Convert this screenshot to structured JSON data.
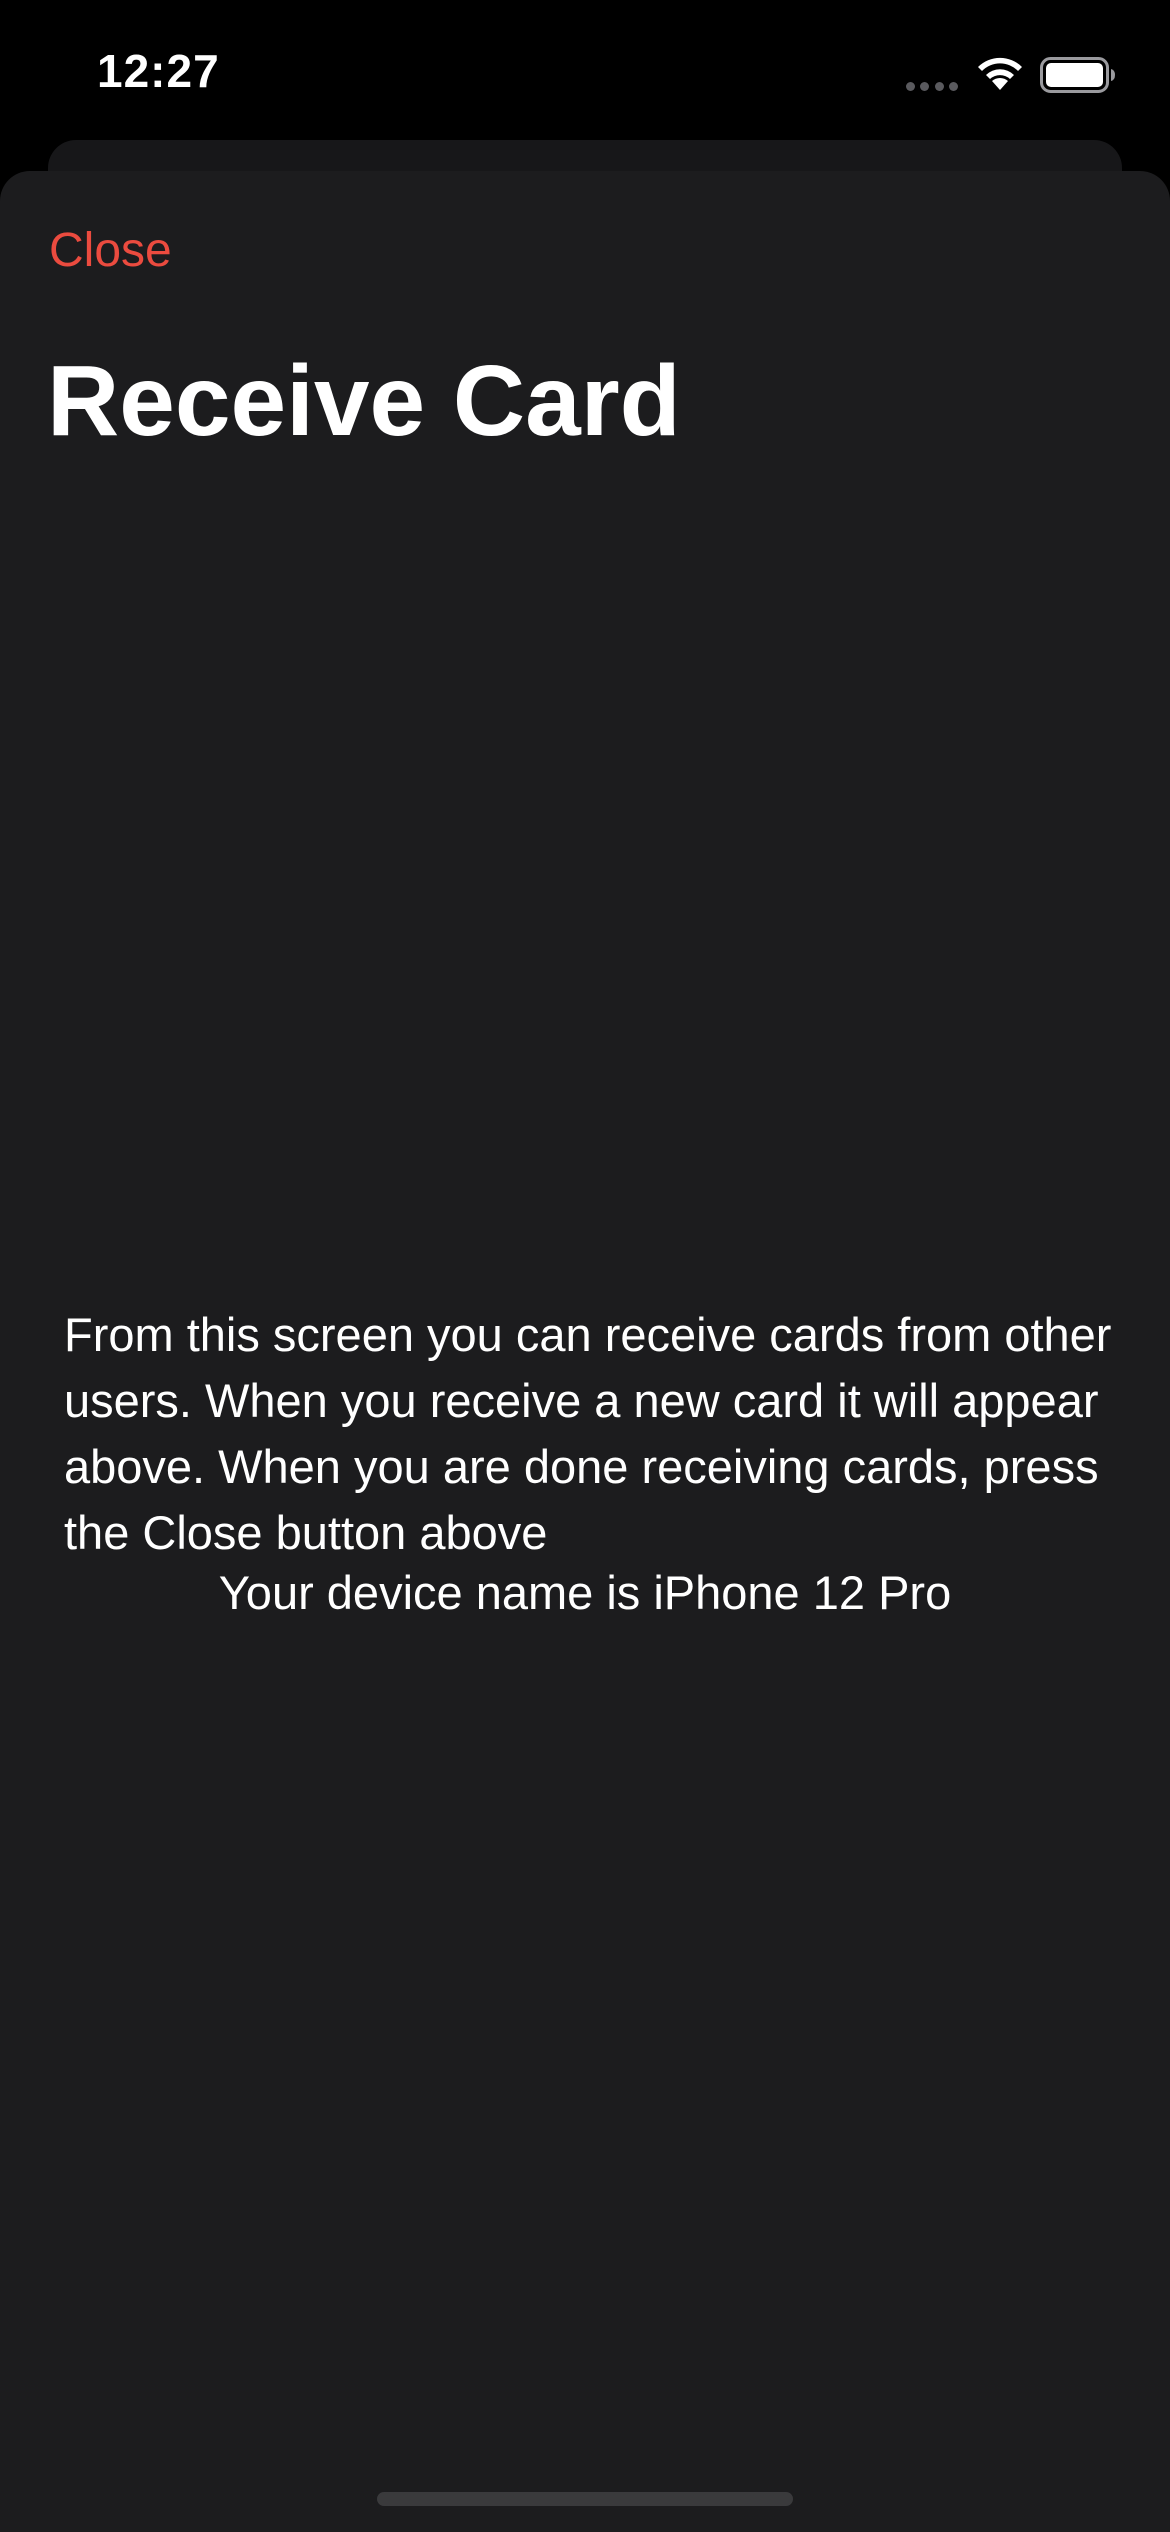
{
  "status_bar": {
    "time": "12:27",
    "icons": [
      "signal-dots-icon",
      "wifi-icon",
      "battery-icon"
    ]
  },
  "sheet": {
    "close_label": "Close",
    "title": "Receive Card",
    "instructions": "From this screen you can receive cards from other users. When you receive a new card it will appear above. When you are done receiving cards, press the Close button above",
    "device_name_text": "Your device name is iPhone 12 Pro"
  },
  "colors": {
    "background": "#000000",
    "sheet": "#1c1c1e",
    "accent": "#eb4b3f",
    "text": "#ffffff"
  }
}
